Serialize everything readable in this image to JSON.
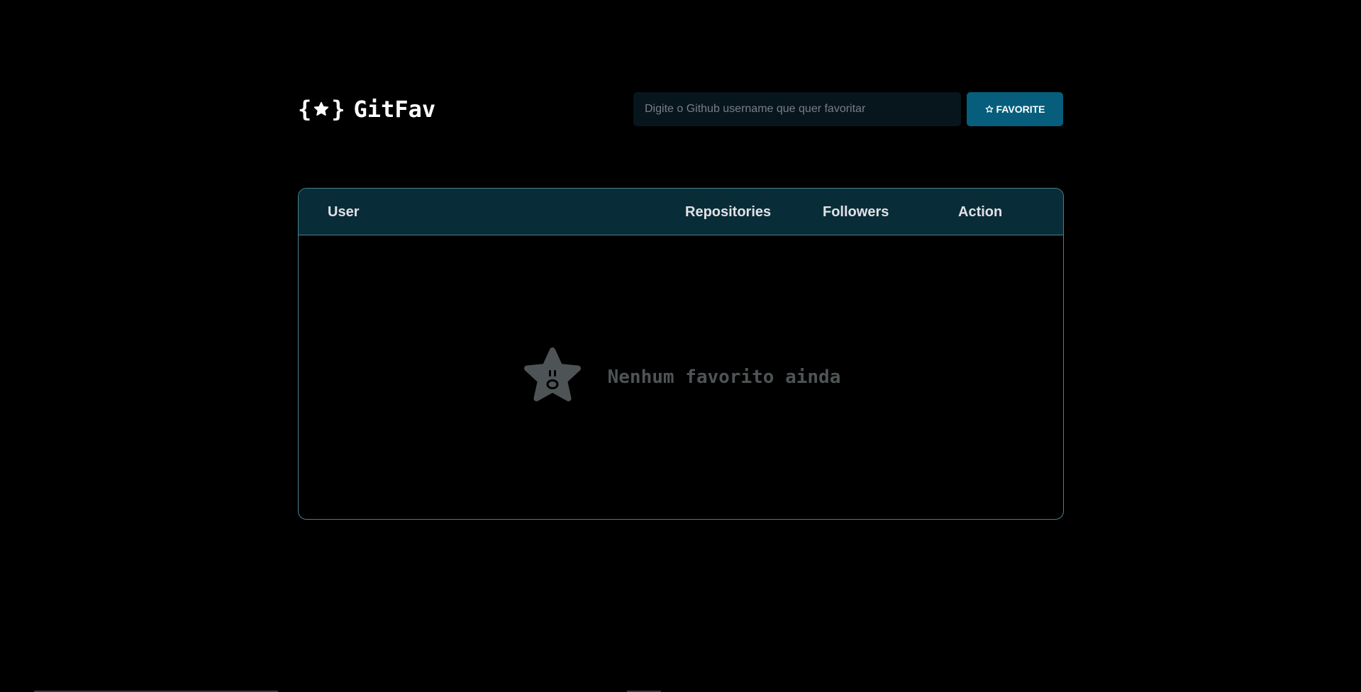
{
  "header": {
    "logo_text": "GitFav",
    "search_placeholder": "Digite o Github username que quer favoritar",
    "search_value": "",
    "favorite_button_label": "FAVORITE"
  },
  "table": {
    "columns": [
      "User",
      "Repositories",
      "Followers",
      "Action"
    ],
    "rows": [],
    "empty_message": "Nenhum favorito ainda"
  },
  "icons": {
    "logo": "star-icon",
    "favorite_button": "star-icon",
    "empty_state": "sad-star-icon"
  },
  "colors": {
    "background": "#000000",
    "accent": "#065e7c",
    "table_header": "#092d38",
    "table_border": "#4a808c",
    "muted_text": "#4e5455"
  }
}
